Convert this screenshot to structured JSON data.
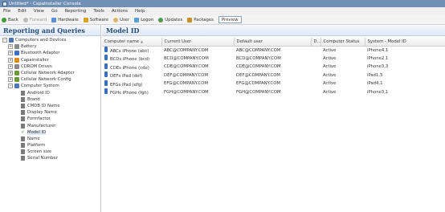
{
  "window": {
    "title": "Untitled* - CapaInstaller Console"
  },
  "menu": [
    "File",
    "Edit",
    "View",
    "Go",
    "Reporting",
    "Tools",
    "Actions",
    "Help"
  ],
  "toolbar": {
    "back": "Back",
    "forward": "Forward",
    "hardware": "Hardware",
    "software": "Software",
    "user": "User",
    "logon": "Logon",
    "updates": "Updates",
    "packages": "Packages",
    "preview": "Preview"
  },
  "left_panel": {
    "title": "Reporting and Queries",
    "tree": [
      {
        "label": "Computers and Devices",
        "kind": "root",
        "expander": "−",
        "color": "#4a76b8"
      },
      {
        "label": "Battery",
        "kind": "node",
        "expander": "+",
        "color": "#8a8a8a"
      },
      {
        "label": "Bluetooth Adapter",
        "kind": "node",
        "expander": "+",
        "color": "#3d6fc4"
      },
      {
        "label": "Capainstaller",
        "kind": "node",
        "expander": "+",
        "color": "#e08a1e"
      },
      {
        "label": "CDROM Drives",
        "kind": "node",
        "expander": "+",
        "color": "#8a8a8a"
      },
      {
        "label": "Cellular Network Adapter",
        "kind": "node",
        "expander": "+",
        "color": "#6a9a3a"
      },
      {
        "label": "Cellular Network Config",
        "kind": "node",
        "expander": "+",
        "color": "#6a9a3a"
      },
      {
        "label": "Computer System",
        "kind": "node",
        "expander": "−",
        "color": "#4a76b8"
      },
      {
        "label": "Android ID",
        "kind": "leaf"
      },
      {
        "label": "Brand",
        "kind": "leaf"
      },
      {
        "label": "CMDB ID Name",
        "kind": "leaf"
      },
      {
        "label": "Display Name",
        "kind": "leaf"
      },
      {
        "label": "Formfactor",
        "kind": "leaf"
      },
      {
        "label": "Manufacturer",
        "kind": "leaf"
      },
      {
        "label": "Model ID",
        "kind": "checked"
      },
      {
        "label": "Name",
        "kind": "leaf"
      },
      {
        "label": "Platform",
        "kind": "leaf"
      },
      {
        "label": "Screen size",
        "kind": "leaf"
      },
      {
        "label": "Serial Number",
        "kind": "leaf"
      }
    ]
  },
  "right_panel": {
    "title": "Model ID",
    "columns": [
      "Computer name",
      "Current User",
      "Default user",
      "D...",
      "Computer Status",
      "System - Model ID"
    ],
    "rows": [
      [
        "ABCs iPhone (abc)",
        "ABC@COMPANY.COM",
        "ABC@COMPANY.COM",
        "",
        "Active",
        "iPhone4,1"
      ],
      [
        "BCDs iPhone (bcd)",
        "BCD@COMPANY.COM",
        "BCD@COMPANY.COM",
        "",
        "Active",
        "iPhone2,1"
      ],
      [
        "CDEs iPhone (cde)",
        "CDE@COMPANY.COM",
        "CDE@COMPANY.COM",
        "",
        "Active",
        "iPhone3,3"
      ],
      [
        "DEFs iPad (def)",
        "DEF@COMPANY.COM",
        "DEF@COMPANY.COM",
        "",
        "Active",
        "iPad1,5"
      ],
      [
        "EFGs iPad (efg)",
        "EFG@COMPANY.COM",
        "EFG@COMPANY.COM",
        "",
        "Active",
        "iPad4,1"
      ],
      [
        "FGHs iPhone (fgh)",
        "FGH@COMPANY.COM",
        "FGH@COMPANY.COM",
        "",
        "Active",
        "iPhone3,1"
      ]
    ]
  }
}
